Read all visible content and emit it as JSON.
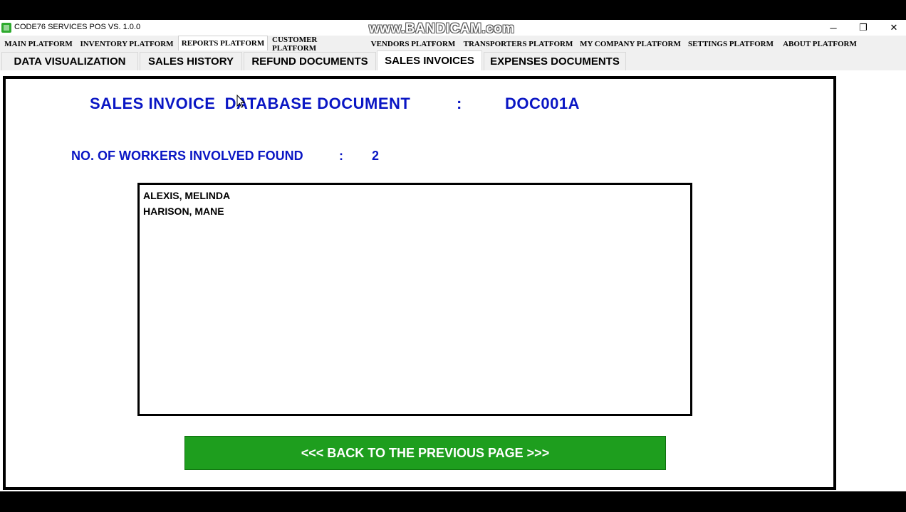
{
  "window": {
    "title": "CODE76 SERVICES POS VS. 1.0.0",
    "watermark": "www.BANDICAM.com",
    "controls": {
      "minimize": "─",
      "maximize": "❐",
      "close": "✕"
    }
  },
  "main_tabs": [
    {
      "label": "MAIN PLATFORM"
    },
    {
      "label": "INVENTORY PLATFORM"
    },
    {
      "label": "REPORTS PLATFORM",
      "active": true
    },
    {
      "label": "CUSTOMER PLATFORM"
    },
    {
      "label": "VENDORS PLATFORM"
    },
    {
      "label": "TRANSPORTERS PLATFORM"
    },
    {
      "label": "MY COMPANY PLATFORM"
    },
    {
      "label": "SETTINGS PLATFORM"
    },
    {
      "label": "ABOUT PLATFORM"
    }
  ],
  "report_tabs": [
    {
      "label": "DATA VISUALIZATION"
    },
    {
      "label": "SALES HISTORY"
    },
    {
      "label": "REFUND DOCUMENTS"
    },
    {
      "label": "SALES INVOICES",
      "active": true
    },
    {
      "label": "EXPENSES DOCUMENTS"
    }
  ],
  "document": {
    "label": "SALES INVOICE  DATABASE DOCUMENT",
    "separator": ":",
    "code": "DOC001A"
  },
  "workers": {
    "label": "NO. OF WORKERS INVOLVED FOUND",
    "separator": ":",
    "count": "2",
    "items": [
      "ALEXIS, MELINDA",
      "HARISON, MANE"
    ]
  },
  "back_button": {
    "label": "<<<  BACK TO THE PREVIOUS PAGE >>>"
  },
  "colors": {
    "accent_text": "#0a16c4",
    "button": "#1e9e1e"
  }
}
